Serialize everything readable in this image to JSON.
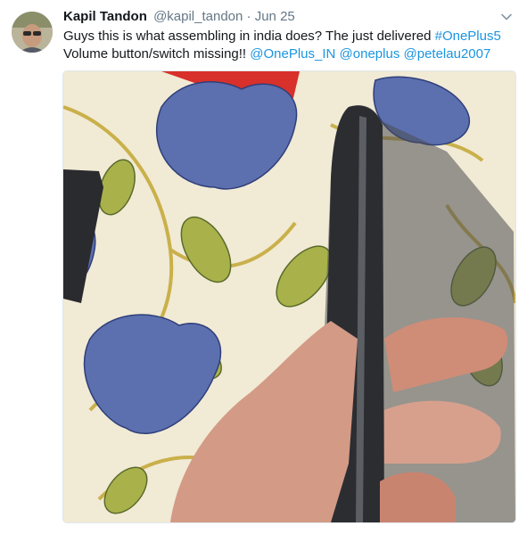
{
  "tweet": {
    "display_name": "Kapil Tandon",
    "handle": "@kapil_tandon",
    "separator": "·",
    "time": "Jun 25",
    "text_segments": [
      {
        "type": "text",
        "value": "Guys this is what assembling in india does? The just delivered "
      },
      {
        "type": "link",
        "value": "#OnePlus5"
      },
      {
        "type": "text",
        "value": "\nVolume button/switch missing!! "
      },
      {
        "type": "link",
        "value": "@OnePlus_IN"
      },
      {
        "type": "text",
        "value": " "
      },
      {
        "type": "link",
        "value": "@oneplus"
      },
      {
        "type": "text",
        "value": " "
      },
      {
        "type": "link",
        "value": "@petelau2007"
      }
    ],
    "icons": {
      "avatar": "avatar-photo",
      "menu": "chevron-down-icon"
    },
    "colors": {
      "link": "#1b95e0",
      "secondary_text": "#657786",
      "border": "#e1e8ed"
    }
  }
}
